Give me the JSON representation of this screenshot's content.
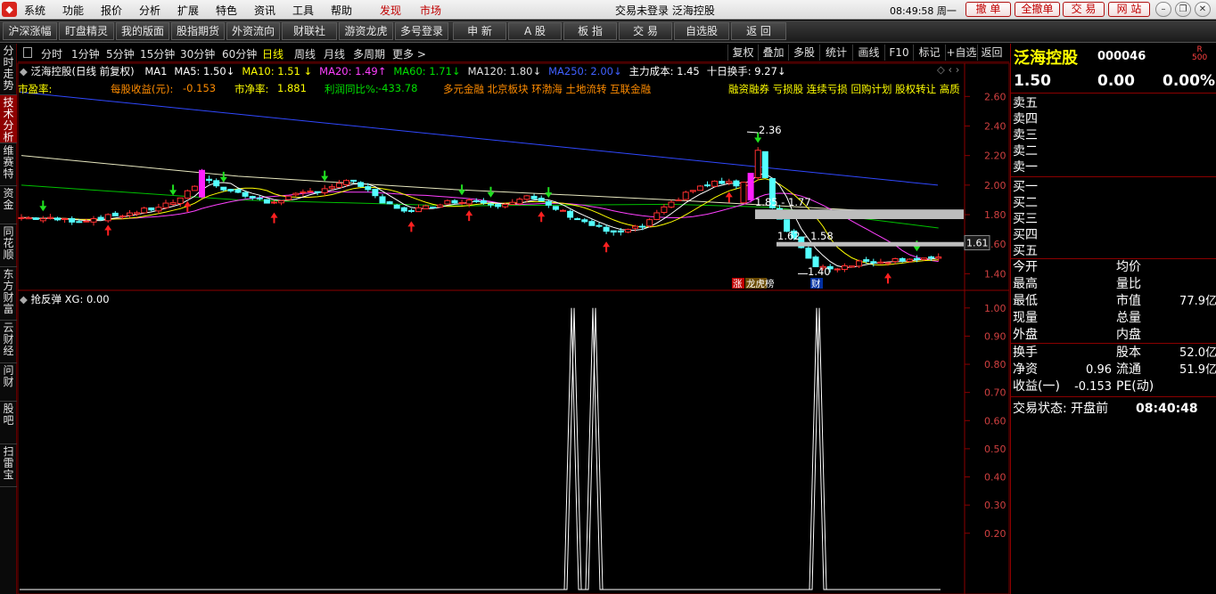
{
  "menubar": {
    "items": [
      "系统",
      "功能",
      "报价",
      "分析",
      "扩展",
      "特色",
      "资讯",
      "工具",
      "帮助"
    ],
    "discover": "发现",
    "market": "市场",
    "title": "交易未登录  泛海控股",
    "clock": "08:49:58 周一",
    "actions": [
      "撤 单",
      "全撤单",
      "交 易",
      "网 站"
    ]
  },
  "toolbar": {
    "items": [
      "沪深涨幅",
      "盯盘精灵",
      "我的版面",
      "股指期货",
      "外资流向",
      "财联社",
      "游资龙虎",
      "多号登录",
      "申 新",
      "A 股",
      "板 指",
      "交 易",
      "自选股",
      "返 回"
    ]
  },
  "sidebar": {
    "tabs": [
      "分时走势",
      "技术分析",
      "维赛特",
      "资金",
      "同花顺",
      "东方财富",
      "云财经",
      "问财",
      "股吧",
      "扫雷宝"
    ],
    "active_index": 1
  },
  "periods": {
    "items": [
      "分时",
      "1分钟",
      "5分钟",
      "15分钟",
      "30分钟",
      "60分钟",
      "日线",
      "周线",
      "月线",
      "多周期",
      "更多 >"
    ],
    "active_index": 6
  },
  "tools": [
    "复权",
    "叠加",
    "多股",
    "统计",
    "画线",
    "F10",
    "标记",
    "+自选",
    "返回"
  ],
  "ma_legend": {
    "title": "泛海控股(日线 前复权)",
    "items": [
      {
        "text": "MA1",
        "color": "#ffffff"
      },
      {
        "text": "MA5: 1.50↓",
        "color": "#ffffff"
      },
      {
        "text": "MA10: 1.51 ↓",
        "color": "#ffff00"
      },
      {
        "text": "MA20: 1.49↑",
        "color": "#ff40ff"
      },
      {
        "text": "MA60: 1.71↓",
        "color": "#00e000"
      },
      {
        "text": "MA120: 1.80↓",
        "color": "#e0e0e0"
      },
      {
        "text": "MA250: 2.00↓",
        "color": "#4060ff"
      },
      {
        "text": "主力成本: 1.45",
        "color": "#ffffff"
      },
      {
        "text": "十日换手: 9.27↓",
        "color": "#ffffff"
      }
    ]
  },
  "fundamentals": {
    "pe_label": "市盈率:",
    "eps_label": "每股收益(元):",
    "eps_value": "-0.153",
    "pb_label": "市净率:",
    "pb_value": "1.881",
    "profit_label": "利润同比%:",
    "profit_value": "-433.78",
    "concepts": "多元金融 北京板块 环渤海 土地流转 互联金融",
    "tags": "融资融券 亏损股 连续亏损 回购计划 股权转让 高质"
  },
  "chart_data": [
    {
      "type": "line",
      "name": "price",
      "ylim": [
        1.3,
        2.65
      ],
      "yticks": [
        1.4,
        1.6,
        1.8,
        2.0,
        2.2,
        2.4,
        2.6
      ],
      "annotations": [
        "2.36",
        "1.85 - 1.77",
        "1.62 - 1.58",
        "1.40"
      ],
      "price_label": "1.61",
      "badges": [
        "涨",
        "龙虎榜",
        "财"
      ]
    },
    {
      "type": "line",
      "name": "抢反弹",
      "legend": "抢反弹  XG: 0.00",
      "ylim": [
        0,
        1.05
      ],
      "yticks": [
        0.2,
        0.3,
        0.4,
        0.5,
        0.6,
        0.7,
        0.8,
        0.9,
        1.0
      ],
      "signal_at_candle": [
        81,
        83,
        102
      ],
      "signal_value": 1.0
    }
  ],
  "quote": {
    "name": "泛海控股",
    "code": "000046",
    "r_mark": "R",
    "r_num": "500",
    "price": "1.50",
    "change": "0.00",
    "pct": "0.00%",
    "asks": [
      "卖五",
      "卖四",
      "卖三",
      "卖二",
      "卖一"
    ],
    "bids": [
      "买一",
      "买二",
      "买三",
      "买四",
      "买五"
    ],
    "stats_left": [
      {
        "label": "今开",
        "value": ""
      },
      {
        "label": "最高",
        "value": ""
      },
      {
        "label": "最低",
        "value": ""
      },
      {
        "label": "现量",
        "value": ""
      },
      {
        "label": "外盘",
        "value": ""
      }
    ],
    "stats_right": [
      {
        "label": "均价",
        "value": ""
      },
      {
        "label": "量比",
        "value": ""
      },
      {
        "label": "市值",
        "value": "77.9亿"
      },
      {
        "label": "总量",
        "value": ""
      },
      {
        "label": "内盘",
        "value": ""
      }
    ],
    "stats2_left": [
      {
        "label": "换手",
        "value": ""
      },
      {
        "label": "净资",
        "value": "0.96"
      },
      {
        "label": "收益(一)",
        "value": "-0.153"
      }
    ],
    "stats2_right": [
      {
        "label": "股本",
        "value": "52.0亿"
      },
      {
        "label": "流通",
        "value": "51.9亿"
      },
      {
        "label": "PE(动)",
        "value": ""
      }
    ],
    "status_label": "交易状态: 开盘前",
    "status_time": "08:40:48"
  }
}
